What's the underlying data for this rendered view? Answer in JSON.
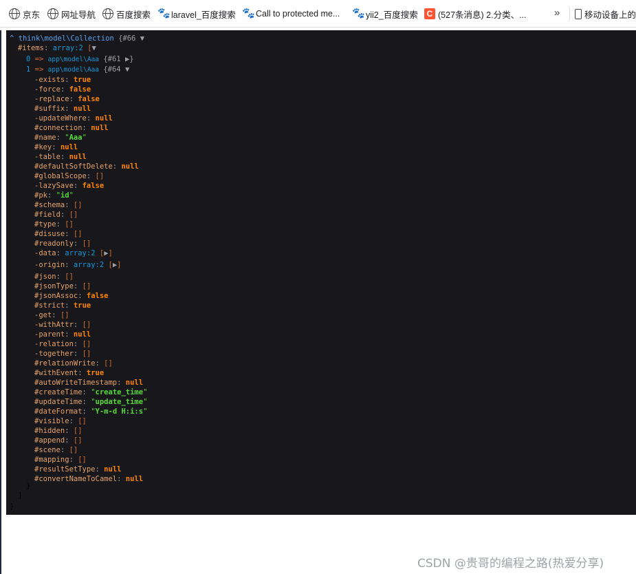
{
  "bookmarks": [
    {
      "label": "京东",
      "icon": "globe-icon"
    },
    {
      "label": "网址导航",
      "icon": "globe-icon"
    },
    {
      "label": "百度搜索",
      "icon": "globe-icon"
    },
    {
      "label": "laravel_百度搜索",
      "icon": "baidu-paw-icon"
    },
    {
      "label": "Call to protected me...",
      "icon": "baidu-paw-icon"
    },
    {
      "label": "yii2_百度搜索",
      "icon": "baidu-paw-icon"
    },
    {
      "label": "(527条消息) 2.分类、...",
      "icon": "csdn-icon"
    }
  ],
  "bookmarks_more": "»",
  "mobile_bookmarks": "移动设备上的书签",
  "dump": {
    "header": {
      "caret": "^",
      "class": "think\\model\\Collection",
      "brace": "{",
      "id": "#66",
      "toggle": "▼"
    },
    "items_line": {
      "key": "#items",
      "note": "array:2",
      "bracket": "[",
      "toggle": "▼"
    },
    "item0": {
      "index": "0",
      "arrow": "=>",
      "class": "app\\model\\Aaa",
      "brace": "{",
      "id": "#61",
      "toggle": "▶",
      "close": "}"
    },
    "item1": {
      "index": "1",
      "arrow": "=>",
      "class": "app\\model\\Aaa",
      "brace": "{",
      "id": "#64",
      "toggle": "▼"
    },
    "props": [
      {
        "key": "-exists",
        "value": "true",
        "type": "bool"
      },
      {
        "key": "-force",
        "value": "false",
        "type": "bool"
      },
      {
        "key": "-replace",
        "value": "false",
        "type": "bool"
      },
      {
        "key": "#suffix",
        "value": "null",
        "type": "bool"
      },
      {
        "key": "-updateWhere",
        "value": "null",
        "type": "bool"
      },
      {
        "key": "#connection",
        "value": "null",
        "type": "bool"
      },
      {
        "key": "#name",
        "value": "Aaa",
        "type": "str"
      },
      {
        "key": "#key",
        "value": "null",
        "type": "bool"
      },
      {
        "key": "-table",
        "value": "null",
        "type": "bool"
      },
      {
        "key": "#defaultSoftDelete",
        "value": "null",
        "type": "bool"
      },
      {
        "key": "#globalScope",
        "value": "[]",
        "type": "arr"
      },
      {
        "key": "-lazySave",
        "value": "false",
        "type": "bool"
      },
      {
        "key": "#pk",
        "value": "id",
        "type": "str"
      },
      {
        "key": "#schema",
        "value": "[]",
        "type": "arr"
      },
      {
        "key": "#field",
        "value": "[]",
        "type": "arr"
      },
      {
        "key": "#type",
        "value": "[]",
        "type": "arr"
      },
      {
        "key": "#disuse",
        "value": "[]",
        "type": "arr"
      },
      {
        "key": "#readonly",
        "value": "[]",
        "type": "arr"
      },
      {
        "key": "-data",
        "value": "array:2",
        "type": "collapsed",
        "bracket": "[",
        "toggle": "▶",
        "close": "]"
      },
      {
        "key": "-origin",
        "value": "array:2",
        "type": "collapsed",
        "bracket": "[",
        "toggle": "▶",
        "close": "]"
      },
      {
        "key": "#json",
        "value": "[]",
        "type": "arr"
      },
      {
        "key": "#jsonType",
        "value": "[]",
        "type": "arr"
      },
      {
        "key": "#jsonAssoc",
        "value": "false",
        "type": "bool"
      },
      {
        "key": "#strict",
        "value": "true",
        "type": "bool"
      },
      {
        "key": "-get",
        "value": "[]",
        "type": "arr"
      },
      {
        "key": "-withAttr",
        "value": "[]",
        "type": "arr"
      },
      {
        "key": "-parent",
        "value": "null",
        "type": "bool"
      },
      {
        "key": "-relation",
        "value": "[]",
        "type": "arr"
      },
      {
        "key": "-together",
        "value": "[]",
        "type": "arr"
      },
      {
        "key": "#relationWrite",
        "value": "[]",
        "type": "arr"
      },
      {
        "key": "#withEvent",
        "value": "true",
        "type": "bool"
      },
      {
        "key": "#autoWriteTimestamp",
        "value": "null",
        "type": "bool"
      },
      {
        "key": "#createTime",
        "value": "create_time",
        "type": "str"
      },
      {
        "key": "#updateTime",
        "value": "update_time",
        "type": "str"
      },
      {
        "key": "#dateFormat",
        "value": "Y-m-d H:i:s",
        "type": "str"
      },
      {
        "key": "#visible",
        "value": "[]",
        "type": "arr"
      },
      {
        "key": "#hidden",
        "value": "[]",
        "type": "arr"
      },
      {
        "key": "#append",
        "value": "[]",
        "type": "arr"
      },
      {
        "key": "#scene",
        "value": "[]",
        "type": "arr"
      },
      {
        "key": "#mapping",
        "value": "[]",
        "type": "arr"
      },
      {
        "key": "#resultSetType",
        "value": "null",
        "type": "bool"
      },
      {
        "key": "#convertNameToCamel",
        "value": "null",
        "type": "bool"
      }
    ],
    "close_item": "}",
    "close_items": "]",
    "close_collection": "}"
  },
  "watermark": "CSDN @贵哥的编程之路(热爱分享)",
  "colors": {
    "dump_bg": "#18171b",
    "key": "#e6a36a",
    "bool": "#ff8400",
    "string": "#56db3a",
    "note": "#1299da"
  }
}
